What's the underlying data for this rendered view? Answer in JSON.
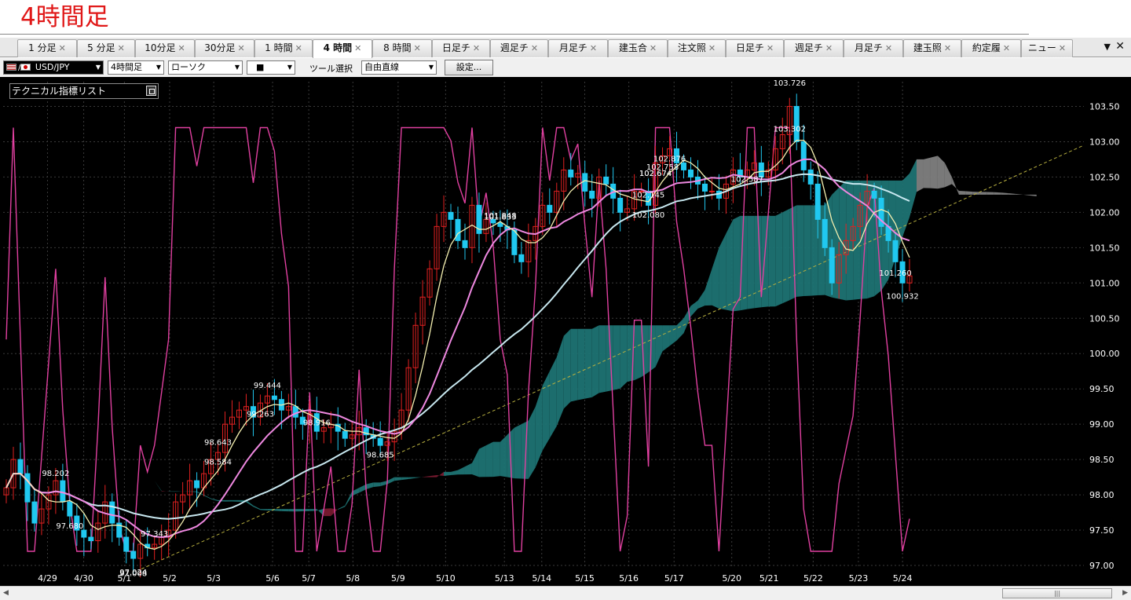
{
  "title": "4時間足",
  "tabs": [
    {
      "label": "1 分足"
    },
    {
      "label": "5 分足"
    },
    {
      "label": "10分足"
    },
    {
      "label": "30分足"
    },
    {
      "label": "1 時間"
    },
    {
      "label": "4 時間",
      "active": true
    },
    {
      "label": "8 時間"
    },
    {
      "label": "日足チ"
    },
    {
      "label": "週足チ"
    },
    {
      "label": "月足チ"
    },
    {
      "label": "建玉合"
    },
    {
      "label": "注文照"
    },
    {
      "label": "日足チ"
    },
    {
      "label": "週足チ"
    },
    {
      "label": "月足チ"
    },
    {
      "label": "建玉照"
    },
    {
      "label": "約定履"
    },
    {
      "label": "ニュー"
    }
  ],
  "tab_close_glyph": "✕",
  "tab_menu_glyph": "▼",
  "window_close_glyph": "✕",
  "toolbar": {
    "symbol": "USD/JPY",
    "timeframe": "4時間足",
    "chart_style": "ローソク",
    "color_picker": "■",
    "tool_label": "ツール選択",
    "tool_value": "自由直線",
    "settings_button": "設定..."
  },
  "indicator_panel": {
    "label": "テクニカル指標リスト"
  },
  "scrollbar": {
    "thumb_glyph": "|||"
  },
  "colors": {
    "background": "#000000",
    "candle_up": "#e02020",
    "candle_down": "#20c8f0",
    "cloud_bull": "#1e7373",
    "cloud_bear": "#7a1a30",
    "cloud_future": "#7f7f7f",
    "rci_line": "#e040a0",
    "ma_fast": "#f5f0b0",
    "ma_mid": "#ee88e0",
    "ma_slow": "#c8e8f0",
    "trendline": "#b8b040",
    "grid": "#3a3a3a"
  },
  "chart_data": {
    "type": "candlestick",
    "symbol": "USD/JPY",
    "timeframe": "4時間足",
    "ylim": [
      96.8,
      103.85
    ],
    "y_ticks": [
      "103.50",
      "103.00",
      "102.50",
      "102.00",
      "101.50",
      "101.00",
      "100.50",
      "100.00",
      "99.50",
      "99.00",
      "98.50",
      "98.00",
      "97.50",
      "97.00"
    ],
    "x_ticks": [
      "4/29",
      "4/30",
      "5/1",
      "5/2",
      "5/3",
      "5/6",
      "5/7",
      "5/8",
      "5/9",
      "5/10",
      "5/13",
      "5/14",
      "5/15",
      "5/16",
      "5/17",
      "5/20",
      "5/21",
      "5/22",
      "5/23",
      "5/24"
    ],
    "close": [
      98.1,
      98.5,
      98.3,
      97.9,
      97.6,
      97.8,
      98.0,
      98.2,
      97.9,
      97.7,
      97.5,
      97.4,
      97.35,
      97.6,
      97.9,
      97.6,
      97.4,
      97.2,
      97.1,
      97.3,
      97.25,
      97.3,
      97.4,
      97.5,
      97.9,
      98.0,
      98.2,
      98.1,
      98.3,
      98.5,
      98.6,
      99.0,
      99.1,
      99.2,
      99.25,
      99.1,
      99.3,
      99.4,
      99.35,
      99.2,
      99.25,
      99.1,
      99.0,
      99.15,
      98.9,
      98.95,
      99.0,
      98.9,
      98.8,
      98.85,
      98.95,
      98.85,
      98.8,
      98.7,
      98.75,
      98.9,
      99.2,
      99.8,
      100.4,
      100.8,
      101.2,
      101.8,
      102.0,
      101.9,
      101.6,
      101.5,
      102.1,
      101.7,
      101.9,
      101.85,
      101.8,
      101.75,
      101.4,
      101.3,
      101.6,
      101.8,
      102.1,
      102.0,
      102.3,
      102.6,
      102.5,
      102.55,
      102.3,
      102.2,
      102.5,
      102.4,
      102.2,
      102.0,
      102.05,
      102.3,
      102.3,
      102.1,
      102.7,
      102.8,
      102.9,
      102.7,
      102.6,
      102.5,
      102.4,
      102.3,
      102.3,
      102.2,
      102.4,
      102.6,
      102.5,
      102.6,
      102.7,
      102.5,
      102.6,
      102.9,
      103.1,
      103.5,
      103.0,
      102.6,
      102.4,
      101.9,
      101.5,
      101.0,
      101.4,
      101.6,
      101.8,
      102.1,
      102.3,
      102.2,
      101.8,
      101.6,
      101.3,
      101.0,
      101.1
    ],
    "price_labels": [
      "103.726",
      "103.302",
      "102.876",
      "102.758",
      "102.674",
      "102.674",
      "102.587",
      "102.145",
      "102.080",
      "101.848",
      "101.833",
      "101.260",
      "100.932",
      "99.444",
      "99.263",
      "98.916",
      "98.685",
      "98.643",
      "98.584",
      "98.202",
      "97.680",
      "97.343",
      "97.024",
      "97.008"
    ]
  }
}
